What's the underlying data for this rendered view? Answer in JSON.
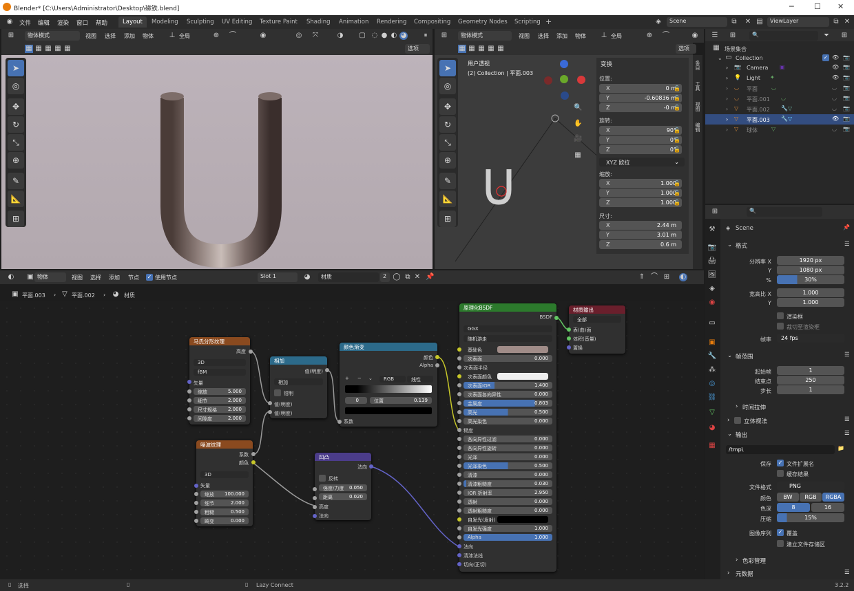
{
  "title": "Blender* [C:\\Users\\Administrator\\Desktop\\磁铁.blend]",
  "menus": [
    "文件",
    "编辑",
    "渲染",
    "窗口",
    "帮助"
  ],
  "workspaces": [
    "Layout",
    "Modeling",
    "Sculpting",
    "UV Editing",
    "Texture Paint",
    "Shading",
    "Animation",
    "Rendering",
    "Compositing",
    "Geometry Nodes",
    "Scripting"
  ],
  "scene": "Scene",
  "viewlayer": "ViewLayer",
  "vp1": {
    "mode": "物体模式",
    "menu": [
      "视图",
      "选择",
      "添加",
      "物体"
    ],
    "orient": "全局",
    "options": "选项"
  },
  "vp2": {
    "mode": "物体模式",
    "menu": [
      "视图",
      "选择",
      "添加",
      "物体"
    ],
    "orient": "全局",
    "options": "选项",
    "view_name": "用户透视",
    "view_info": "(2) Collection | 平面.003"
  },
  "npanel": {
    "header": "变换",
    "loc_label": "位置:",
    "loc": [
      [
        "X",
        "0 m"
      ],
      [
        "Y",
        "-0.60836 m"
      ],
      [
        "Z",
        "-0 m"
      ]
    ],
    "rot_label": "旋转:",
    "rot": [
      [
        "X",
        "90°"
      ],
      [
        "Y",
        "0°"
      ],
      [
        "Z",
        "0°"
      ]
    ],
    "rot_mode": "XYZ 欧拉",
    "scale_label": "缩放:",
    "scale": [
      [
        "X",
        "1.000"
      ],
      [
        "Y",
        "1.000"
      ],
      [
        "Z",
        "1.000"
      ]
    ],
    "dim_label": "尺寸:",
    "dim": [
      [
        "X",
        "2.44 m"
      ],
      [
        "Y",
        "3.01 m"
      ],
      [
        "Z",
        "0.6 m"
      ]
    ],
    "tabs": [
      "条目",
      "工具",
      "视图",
      "编辑"
    ]
  },
  "ne": {
    "type": "物体",
    "menu": [
      "视图",
      "选择",
      "添加",
      "节点"
    ],
    "use_nodes": "使用节点",
    "slot": "Slot 1",
    "material": "材质",
    "users": "2",
    "breadcrumb": [
      "平面.003",
      "平面.002",
      "材质"
    ]
  },
  "nodes": {
    "musgrave": {
      "title": "马氏分形纹理",
      "out": "高度",
      "dim": "3D",
      "type": "fBM",
      "in": "矢量",
      "f": [
        [
          "缩放",
          "5.000"
        ],
        [
          "细节",
          "2.000"
        ],
        [
          "尺寸规格",
          "2.000"
        ],
        [
          "间隙度",
          "2.000"
        ]
      ]
    },
    "noise": {
      "title": "噪波纹理",
      "out": [
        "系数",
        "颜色"
      ],
      "dim": "3D",
      "in": "矢量",
      "f": [
        [
          "缩放",
          "100.000"
        ],
        [
          "细节",
          "2.000"
        ],
        [
          "粗糙",
          "0.500"
        ],
        [
          "畸变",
          "0.000"
        ]
      ]
    },
    "add": {
      "title": "相加",
      "out": "值(明度)",
      "op": "相加",
      "clamp": "钳制",
      "in": [
        "值(明度)",
        "值(明度)"
      ]
    },
    "ramp": {
      "title": "颜色渐变",
      "out": [
        "颜色",
        "Alpha"
      ],
      "mode": "RGB",
      "interp": "线性",
      "idx": "0",
      "pos_label": "位置",
      "pos": "0.139",
      "in": "系数"
    },
    "bump": {
      "title": "凹凸",
      "out": "法向",
      "invert": "反转",
      "f": [
        [
          "强度/力度",
          "0.050"
        ],
        [
          "距离",
          "0.020"
        ]
      ],
      "in": [
        "高度",
        "法向"
      ]
    },
    "bsdf": {
      "title": "原理化BSDF",
      "out": "BSDF",
      "dist": "GGX",
      "sss": "随机游走",
      "rows": [
        [
          "基础色",
          ""
        ],
        [
          "次表面",
          "0.000"
        ],
        [
          "次表面半径",
          ""
        ],
        [
          "次表面颜色",
          ""
        ],
        [
          "次表面IOR",
          "1.400"
        ],
        [
          "次表面各向异性",
          "0.000"
        ],
        [
          "金属度",
          "0.803"
        ],
        [
          "高光",
          "0.500"
        ],
        [
          "高光染色",
          "0.000"
        ],
        [
          "糙度",
          ""
        ],
        [
          "各向异性过滤",
          "0.000"
        ],
        [
          "各向异性旋转",
          "0.000"
        ],
        [
          "光泽",
          "0.000"
        ],
        [
          "光泽染色",
          "0.500"
        ],
        [
          "清漆",
          "0.000"
        ],
        [
          "清漆粗糙度",
          "0.030"
        ],
        [
          "IOR 折射率",
          "2.950"
        ],
        [
          "透射",
          "0.000"
        ],
        [
          "透射粗糙度",
          "0.000"
        ],
        [
          "自发光(发射)",
          ""
        ],
        [
          "自发光强度",
          "1.000"
        ],
        [
          "Alpha",
          "1.000"
        ],
        [
          "法向",
          ""
        ],
        [
          "清漆法线",
          ""
        ],
        [
          "切向(正切)",
          ""
        ]
      ]
    },
    "output": {
      "title": "材质输出",
      "target": "全部",
      "in": [
        "表(曲)面",
        "体积(音量)",
        "置换"
      ]
    }
  },
  "outliner": {
    "root": "场景集合",
    "items": [
      [
        "Collection",
        ""
      ],
      [
        "Camera",
        ""
      ],
      [
        "Light",
        ""
      ],
      [
        "平面",
        ""
      ],
      [
        "平面.001",
        ""
      ],
      [
        "平面.002",
        ""
      ],
      [
        "平面.003",
        ""
      ],
      [
        "球体",
        ""
      ]
    ]
  },
  "props": {
    "scene": "Scene",
    "format": "格式",
    "res_x_label": "分辨率 X",
    "res_x": "1920 px",
    "res_y_label": "Y",
    "res_y": "1080 px",
    "pct_label": "%",
    "pct": "30%",
    "aspect_x_label": "宽高比 X",
    "aspect_x": "1.000",
    "aspect_y_label": "Y",
    "aspect_y": "1.000",
    "border": "渲染框",
    "crop": "裁切至渲染框",
    "fps_label": "帧率",
    "fps": "24 fps",
    "frame_range": "帧范围",
    "start_label": "起始帧",
    "start": "1",
    "end_label": "结束点",
    "end": "250",
    "step_label": "步长",
    "step": "1",
    "time_stretch": "时间拉伸",
    "stereo": "立体视法",
    "output": "输出",
    "path": "/tmp\\",
    "save_label": "保存",
    "ext": "文件扩展名",
    "cache": "缓存结果",
    "format_label": "文件格式",
    "file_format": "PNG",
    "color_label": "颜色",
    "color_opts": [
      "BW",
      "RGB",
      "RGBA"
    ],
    "depth_label": "色深",
    "depths": [
      "8",
      "16"
    ],
    "comp_label": "压缩",
    "comp": "15%",
    "seq_label": "图像序列",
    "overwrite": "覆盖",
    "placeholders": "建立文件存储区",
    "color_mgmt": "色彩管理",
    "metadata": "元数据"
  },
  "status": {
    "select": "选择",
    "lazy": "Lazy Connect",
    "version": "3.2.2"
  },
  "colors": {
    "accent": "#4772b3",
    "texture_header": "#8a4a1f",
    "converter_header": "#2c6a8a",
    "vector_header": "#4b3c8a",
    "shader_header": "#2c7a2c",
    "output_header": "#6a1f2c",
    "link_yellow": "#c7c729",
    "link_purple": "#6363c7",
    "link_gray": "#9a9a9a",
    "link_green": "#63c763"
  }
}
